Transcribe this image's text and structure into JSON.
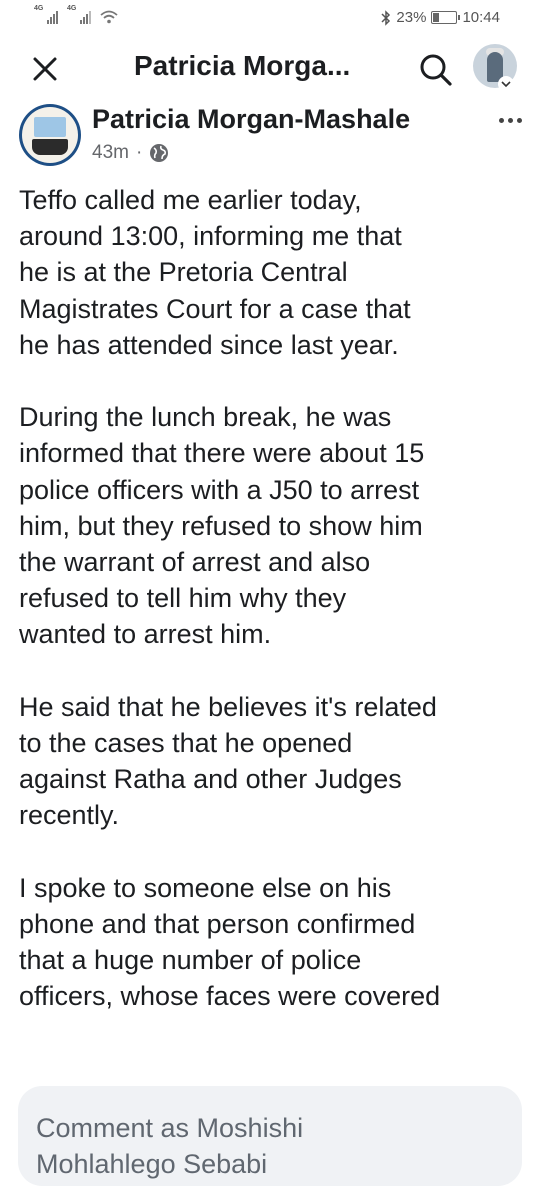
{
  "status_bar": {
    "network_1": "4G",
    "network_2": "4G",
    "battery_percent_label": "23%",
    "battery_level": 0.23,
    "time": "10:44"
  },
  "header": {
    "title": "Patricia Morga...",
    "icons": {
      "close": "close-icon",
      "search": "search-icon",
      "profile": "profile-avatar"
    }
  },
  "post": {
    "author": "Patricia Morgan-Mashale",
    "time_ago": "43m",
    "separator": "·",
    "audience_icon": "globe-icon",
    "paragraphs": [
      [
        "Teffo called me earlier today,",
        "around 13:00, informing me that",
        "he is at the Pretoria Central",
        "Magistrates Court for a case that",
        "he has attended since last year."
      ],
      [
        "During the lunch break, he was",
        "informed that there were about 15",
        "police officers with a J50 to arrest",
        "him, but they refused to show him",
        "the warrant of arrest and also",
        "refused to tell him why they",
        "wanted to arrest him."
      ],
      [
        "He said that he believes it's related",
        "to the cases that he opened",
        "against Ratha and other Judges",
        "recently."
      ],
      [
        "I spoke to someone else on his",
        "phone and that person confirmed",
        "that a huge number of police",
        "officers, whose faces were covered"
      ]
    ]
  },
  "comment": {
    "placeholder_line1": "Comment as Moshishi",
    "placeholder_line2": "Mohlahlego Sebabi"
  }
}
